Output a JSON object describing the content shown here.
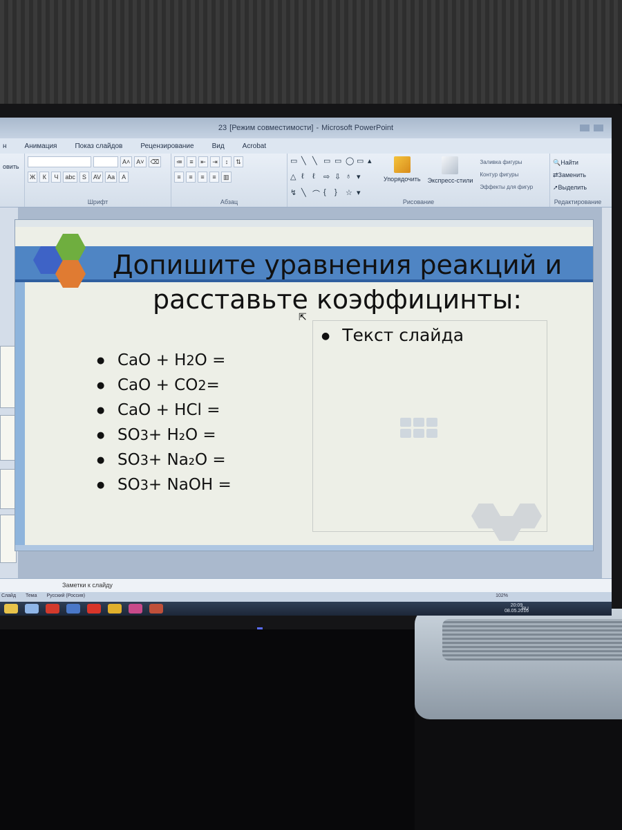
{
  "window": {
    "title_doc": "23",
    "title_mode": "[Режим совместимости]",
    "title_app": "Microsoft PowerPoint"
  },
  "ribbon": {
    "tabs": [
      "н",
      "Анимация",
      "Показ слайдов",
      "Рецензирование",
      "Вид",
      "Acrobat"
    ],
    "clipboard_cut_label": "овить",
    "font_group_label": "Шрифт",
    "paragraph_group_label": "Абзац",
    "drawing_group_label": "Рисование",
    "editing_group_label": "Редактирование",
    "arrange_label": "Упорядочить",
    "quick_styles_label": "Экспресс-стили",
    "shape_fill_label": "Заливка фигуры",
    "shape_outline_label": "Контур фигуры",
    "shape_effects_label": "Эффекты для фигур",
    "find_label": "Найти",
    "replace_label": "Заменить",
    "select_label": "Выделить"
  },
  "slide": {
    "title": "Допишите уравнения реакций и расставьте коэффицинты:",
    "placeholder_text": "Текст слайда",
    "equations": [
      {
        "a": "CaO + H",
        "sub": "2",
        "b": "O  ="
      },
      {
        "a": "CaO + CO",
        "sub": "2",
        "b": "  ="
      },
      {
        "a": "CaO + HCl =",
        "sub": "",
        "b": ""
      },
      {
        "a": "SO",
        "sub": "3",
        "b": "+ H₂O  ="
      },
      {
        "a": "SO",
        "sub": "3",
        "b": " + Na₂O  ="
      },
      {
        "a": "SO",
        "sub": "3",
        "b": "+ NaOH ="
      }
    ]
  },
  "notes": {
    "placeholder": "Заметки к слайду"
  },
  "statusbar": {
    "slide_label": "Слайд",
    "theme_label": "Тема",
    "language": "Русский (Россия)",
    "zoom": "102%"
  },
  "taskbar": {
    "lang": "RU",
    "time": "20:09",
    "date": "08.05.2016"
  },
  "colors": {
    "title_band": "#4f85c4",
    "hex_blue": "#3e63c6",
    "hex_green": "#6fae3f",
    "hex_orange": "#e07b32"
  }
}
